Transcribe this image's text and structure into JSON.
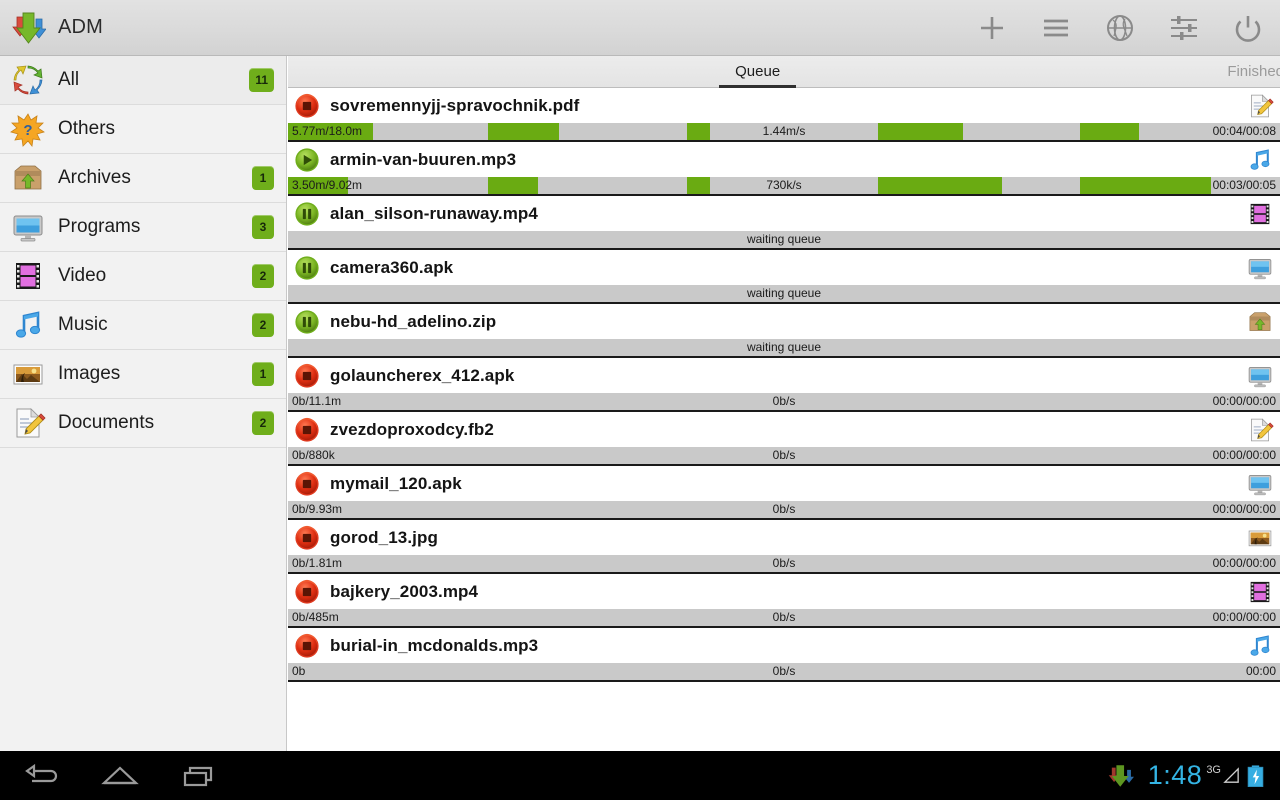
{
  "app": {
    "title": "ADM",
    "logo_icon": "adm-download-arrows-logo"
  },
  "toolbar": {
    "buttons": [
      {
        "name": "add-download-button",
        "icon": "plus-icon",
        "label": "Add"
      },
      {
        "name": "menu-button",
        "icon": "hamburger-menu-icon",
        "label": "Menu"
      },
      {
        "name": "browser-button",
        "icon": "globe-icon",
        "label": "Browser"
      },
      {
        "name": "settings-button",
        "icon": "sliders-icon",
        "label": "Settings"
      },
      {
        "name": "exit-button",
        "icon": "power-icon",
        "label": "Exit"
      }
    ]
  },
  "sidebar": {
    "items": [
      {
        "label": "All",
        "count": "11",
        "icon": "refresh-arrows-icon",
        "selected": true
      },
      {
        "label": "Others",
        "count": "",
        "icon": "starburst-question-icon",
        "selected": false
      },
      {
        "label": "Archives",
        "count": "1",
        "icon": "archive-box-icon",
        "selected": false
      },
      {
        "label": "Programs",
        "count": "3",
        "icon": "monitor-icon",
        "selected": false
      },
      {
        "label": "Video",
        "count": "2",
        "icon": "film-strip-icon",
        "selected": false
      },
      {
        "label": "Music",
        "count": "2",
        "icon": "music-note-icon",
        "selected": false
      },
      {
        "label": "Images",
        "count": "1",
        "icon": "photo-icon",
        "selected": false
      },
      {
        "label": "Documents",
        "count": "2",
        "icon": "document-pencil-icon",
        "selected": false
      }
    ]
  },
  "tabs": {
    "queue_label": "Queue",
    "finished_label": "Finished",
    "active": "Queue"
  },
  "downloads": [
    {
      "name": "sovremennyjj-spravochnik.pdf",
      "state": "downloading",
      "state_icon": "stop-red-icon",
      "type_icon": "document-pencil-icon",
      "progress_left": "5.77m/18.0m",
      "progress_mid": "1.44m/s",
      "progress_right": "00:04/00:08",
      "segments": [
        [
          0,
          8.6
        ],
        [
          20.2,
          27.3
        ],
        [
          40.2,
          42.5
        ],
        [
          59.5,
          68.0
        ],
        [
          79.8,
          85.8
        ]
      ]
    },
    {
      "name": "armin-van-buuren.mp3",
      "state": "paused",
      "state_icon": "play-green-icon",
      "type_icon": "music-note-icon",
      "progress_left": "3.50m/9.02m",
      "progress_mid": "730k/s",
      "progress_right": "00:03/00:05",
      "segments": [
        [
          0,
          6.0
        ],
        [
          20.2,
          25.2
        ],
        [
          40.2,
          42.5
        ],
        [
          59.5,
          72.0
        ],
        [
          79.8,
          93.0
        ]
      ]
    },
    {
      "name": "alan_silson-runaway.mp4",
      "state": "waiting",
      "state_icon": "pause-green-icon",
      "type_icon": "film-strip-icon",
      "progress_left": "",
      "progress_mid": "waiting queue",
      "progress_right": "",
      "segments": []
    },
    {
      "name": "camera360.apk",
      "state": "waiting",
      "state_icon": "pause-green-icon",
      "type_icon": "monitor-icon",
      "progress_left": "",
      "progress_mid": "waiting queue",
      "progress_right": "",
      "segments": []
    },
    {
      "name": "nebu-hd_adelino.zip",
      "state": "waiting",
      "state_icon": "pause-green-icon",
      "type_icon": "archive-box-icon",
      "progress_left": "",
      "progress_mid": "waiting queue",
      "progress_right": "",
      "segments": []
    },
    {
      "name": "golauncherex_412.apk",
      "state": "stopped",
      "state_icon": "stop-red-icon",
      "type_icon": "monitor-icon",
      "progress_left": "0b/11.1m",
      "progress_mid": "0b/s",
      "progress_right": "00:00/00:00",
      "segments": []
    },
    {
      "name": "zvezdoproxodcy.fb2",
      "state": "stopped",
      "state_icon": "stop-red-icon",
      "type_icon": "document-pencil-icon",
      "progress_left": "0b/880k",
      "progress_mid": "0b/s",
      "progress_right": "00:00/00:00",
      "segments": []
    },
    {
      "name": "mymail_120.apk",
      "state": "stopped",
      "state_icon": "stop-red-icon",
      "type_icon": "monitor-icon",
      "progress_left": "0b/9.93m",
      "progress_mid": "0b/s",
      "progress_right": "00:00/00:00",
      "segments": []
    },
    {
      "name": "gorod_13.jpg",
      "state": "stopped",
      "state_icon": "stop-red-icon",
      "type_icon": "photo-icon",
      "progress_left": "0b/1.81m",
      "progress_mid": "0b/s",
      "progress_right": "00:00/00:00",
      "segments": []
    },
    {
      "name": "bajkery_2003.mp4",
      "state": "stopped",
      "state_icon": "stop-red-icon",
      "type_icon": "film-strip-icon",
      "progress_left": "0b/485m",
      "progress_mid": "0b/s",
      "progress_right": "00:00/00:00",
      "segments": []
    },
    {
      "name": "burial-in_mcdonalds.mp3",
      "state": "stopped",
      "state_icon": "stop-red-icon",
      "type_icon": "music-note-icon",
      "progress_left": "0b",
      "progress_mid": "0b/s",
      "progress_right": "00:00",
      "segments": []
    }
  ],
  "navbar": {
    "back_label": "Back",
    "home_label": "Home",
    "recents_label": "Recent apps",
    "status": {
      "download_icon": "adm-download-arrows-logo",
      "time": "1:48",
      "network": "3G",
      "signal_icon": "signal-triangle-icon",
      "battery_icon": "battery-charging-icon"
    }
  },
  "colors": {
    "accent_green": "#6aab12",
    "badge_green": "#6fae1b",
    "clock_blue": "#34b4e4",
    "progress_track": "#c9c9c9"
  }
}
